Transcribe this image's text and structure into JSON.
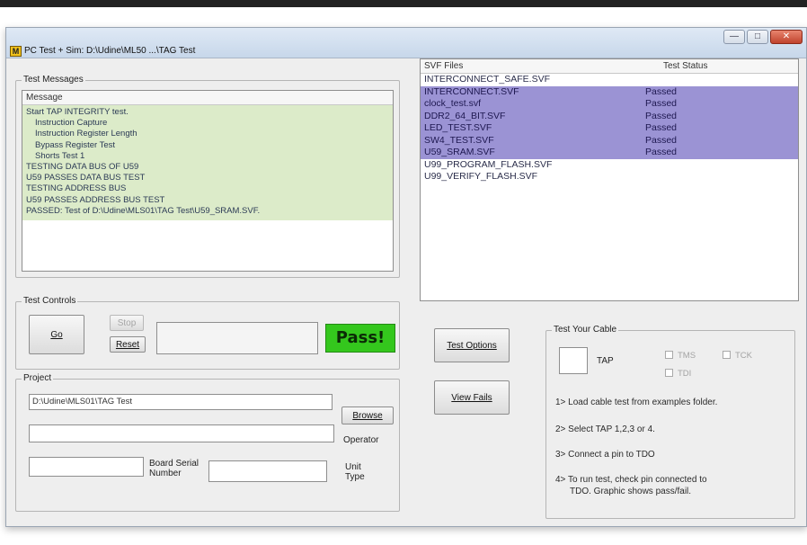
{
  "window": {
    "title": "PC Test + Sim: D:\\Udine\\ML50 ...\\TAG Test",
    "app_icon": "M",
    "controls": {
      "minimize": "—",
      "maximize": "□",
      "close": "✕"
    }
  },
  "test_messages": {
    "group_label": "Test Messages",
    "column_header": "Message",
    "lines": [
      "Start TAP INTEGRITY test.",
      "Instruction Capture",
      "Instruction Register Length",
      "Bypass Register Test",
      "Shorts Test 1",
      "TESTING DATA BUS OF U59",
      "U59 PASSES DATA BUS TEST",
      "TESTING ADDRESS BUS",
      "U59 PASSES ADDRESS BUS TEST",
      "PASSED: Test of D:\\Udine\\MLS01\\TAG Test\\U59_SRAM.SVF."
    ]
  },
  "svf_list": {
    "col_files": "SVF Files",
    "col_status": "Test Status",
    "rows": [
      {
        "name": "INTERCONNECT_SAFE.SVF",
        "status": ""
      },
      {
        "name": "INTERCONNECT.SVF",
        "status": "Passed"
      },
      {
        "name": "clock_test.svf",
        "status": "Passed"
      },
      {
        "name": "DDR2_64_BIT.SVF",
        "status": "Passed"
      },
      {
        "name": "LED_TEST.SVF",
        "status": "Passed"
      },
      {
        "name": "SW4_TEST.SVF",
        "status": "Passed"
      },
      {
        "name": "U59_SRAM.SVF",
        "status": "Passed"
      },
      {
        "name": "U99_PROGRAM_FLASH.SVF",
        "status": ""
      },
      {
        "name": "U99_VERIFY_FLASH.SVF",
        "status": ""
      }
    ]
  },
  "test_controls": {
    "group_label": "Test Controls",
    "go_label": "Go",
    "stop_label": "Stop",
    "reset_label": "Reset",
    "progress_text": "",
    "result": "Pass!",
    "result_color": "#34c71d"
  },
  "project": {
    "group_label": "Project",
    "path_value": "D:\\Udine\\MLS01\\TAG Test",
    "browse_label": "Browse",
    "operator_value": "",
    "operator_label": "Operator",
    "board_serial_value": "",
    "board_serial_label": "Board Serial Number",
    "unit_type_value": "",
    "unit_type_label": "Unit Type"
  },
  "actions": {
    "test_options_label": "Test Options",
    "view_fails_label": "View Fails"
  },
  "cable": {
    "group_label": "Test Your Cable",
    "tap_value": "",
    "tap_label": "TAP",
    "checkboxes": [
      "TMS",
      "TCK",
      "TDI"
    ],
    "instructions": [
      "1> Load cable test from examples folder.",
      "2> Select TAP 1,2,3 or 4.",
      "3> Connect a pin to TDO",
      "4> To run test, check pin connected to",
      "TDO. Graphic shows pass/fail."
    ]
  }
}
